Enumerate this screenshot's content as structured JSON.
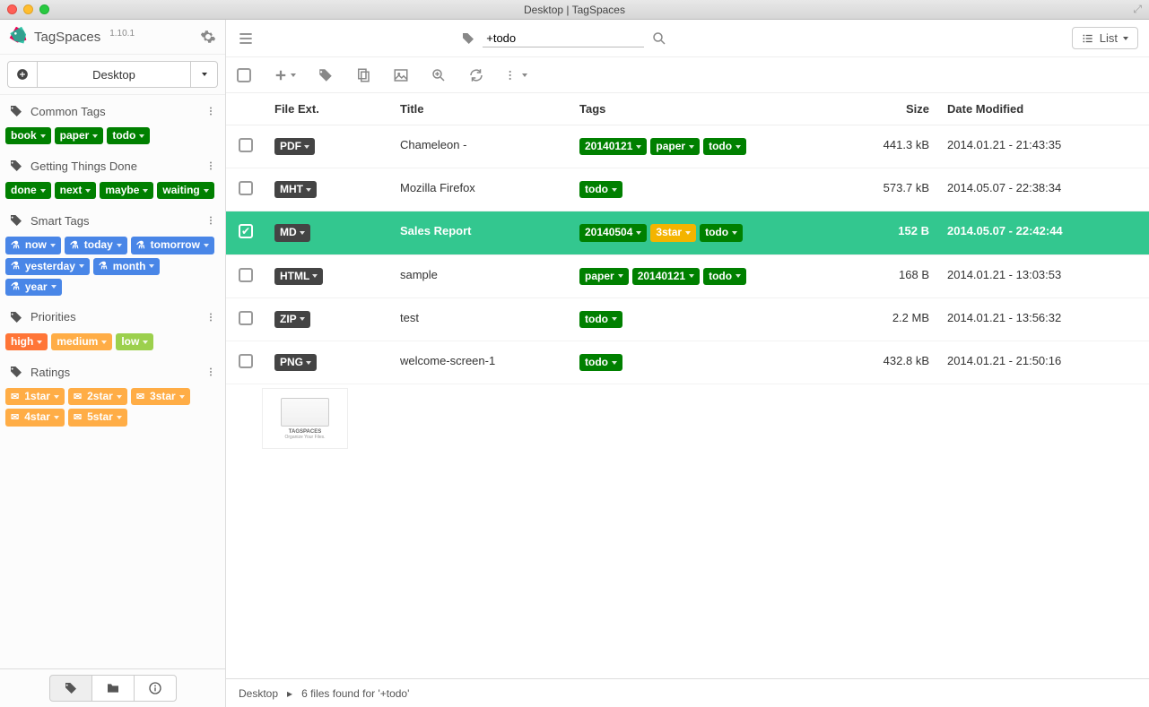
{
  "window": {
    "title": "Desktop | TagSpaces"
  },
  "app": {
    "name": "TagSpaces",
    "version": "1.10.1"
  },
  "location": {
    "name": "Desktop"
  },
  "search": {
    "value": "+todo"
  },
  "view_toggle": {
    "label": "List"
  },
  "sidebar": {
    "groups": [
      {
        "title": "Common Tags",
        "tags": [
          {
            "label": "book",
            "color": "green"
          },
          {
            "label": "paper",
            "color": "green"
          },
          {
            "label": "todo",
            "color": "green"
          }
        ]
      },
      {
        "title": "Getting Things Done",
        "tags": [
          {
            "label": "done",
            "color": "green"
          },
          {
            "label": "next",
            "color": "green"
          },
          {
            "label": "maybe",
            "color": "green"
          },
          {
            "label": "waiting",
            "color": "green"
          }
        ]
      },
      {
        "title": "Smart Tags",
        "tags": [
          {
            "label": "now",
            "color": "blue",
            "icon": "flask"
          },
          {
            "label": "today",
            "color": "blue",
            "icon": "flask"
          },
          {
            "label": "tomorrow",
            "color": "blue",
            "icon": "flask"
          },
          {
            "label": "yesterday",
            "color": "blue",
            "icon": "flask"
          },
          {
            "label": "month",
            "color": "blue",
            "icon": "flask"
          },
          {
            "label": "year",
            "color": "blue",
            "icon": "flask"
          }
        ]
      },
      {
        "title": "Priorities",
        "tags": [
          {
            "label": "high",
            "color": "orange"
          },
          {
            "label": "medium",
            "color": "gold"
          },
          {
            "label": "low",
            "color": "lime"
          }
        ]
      },
      {
        "title": "Ratings",
        "tags": [
          {
            "label": "1star",
            "color": "gold",
            "icon": "star"
          },
          {
            "label": "2star",
            "color": "gold",
            "icon": "star"
          },
          {
            "label": "3star",
            "color": "gold",
            "icon": "star"
          },
          {
            "label": "4star",
            "color": "gold",
            "icon": "star"
          },
          {
            "label": "5star",
            "color": "gold",
            "icon": "star"
          }
        ]
      }
    ]
  },
  "columns": {
    "ext": "File Ext.",
    "title": "Title",
    "tags": "Tags",
    "size": "Size",
    "date": "Date Modified"
  },
  "files": [
    {
      "ext": "PDF",
      "title": "Chameleon -",
      "tags": [
        {
          "label": "20140121",
          "color": "green"
        },
        {
          "label": "paper",
          "color": "green"
        },
        {
          "label": "todo",
          "color": "green"
        }
      ],
      "size": "441.3 kB",
      "date": "2014.01.21 - 21:43:35",
      "selected": false
    },
    {
      "ext": "MHT",
      "title": "Mozilla Firefox",
      "tags": [
        {
          "label": "todo",
          "color": "green"
        }
      ],
      "size": "573.7 kB",
      "date": "2014.05.07 - 22:38:34",
      "selected": false
    },
    {
      "ext": "MD",
      "title": "Sales Report",
      "tags": [
        {
          "label": "20140504",
          "color": "green"
        },
        {
          "label": "3star",
          "color": "gold2"
        },
        {
          "label": "todo",
          "color": "green"
        }
      ],
      "size": "152 B",
      "date": "2014.05.07 - 22:42:44",
      "selected": true
    },
    {
      "ext": "HTML",
      "title": "sample",
      "tags": [
        {
          "label": "paper",
          "color": "green"
        },
        {
          "label": "20140121",
          "color": "green"
        },
        {
          "label": "todo",
          "color": "green"
        }
      ],
      "size": "168 B",
      "date": "2014.01.21 - 13:03:53",
      "selected": false
    },
    {
      "ext": "ZIP",
      "title": "test",
      "tags": [
        {
          "label": "todo",
          "color": "green"
        }
      ],
      "size": "2.2 MB",
      "date": "2014.01.21 - 13:56:32",
      "selected": false
    },
    {
      "ext": "PNG",
      "title": "welcome-screen-1",
      "tags": [
        {
          "label": "todo",
          "color": "green"
        }
      ],
      "size": "432.8 kB",
      "date": "2014.01.21 - 21:50:16",
      "selected": false,
      "thumb": true,
      "thumb_title": "TAGSPACES",
      "thumb_sub": "Organize Your Files."
    }
  ],
  "status": {
    "path": "Desktop",
    "result": "6 files found for '+todo'"
  }
}
